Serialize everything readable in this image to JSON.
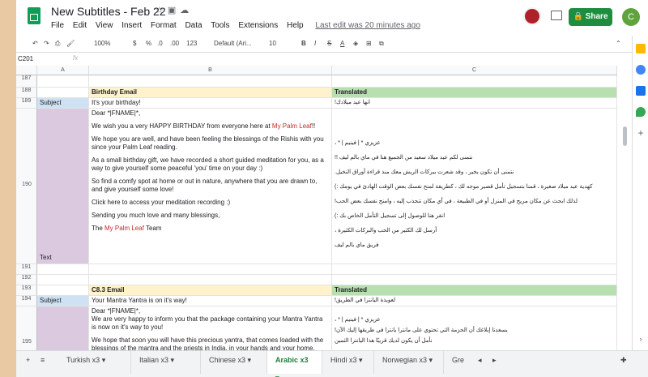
{
  "doc": {
    "title": "New Subtitles - Feb 22",
    "last_edit": "Last edit was 20 minutes ago"
  },
  "menu": [
    "File",
    "Edit",
    "View",
    "Insert",
    "Format",
    "Data",
    "Tools",
    "Extensions",
    "Help"
  ],
  "share_label": "Share",
  "avatar_letter": "C",
  "toolbar": {
    "zoom": "100%",
    "currency": "$",
    "percent": "%",
    "dec1": ".0",
    "dec2": ".00",
    "fmt": "123",
    "font": "Default (Ari...",
    "size": "10",
    "bold": "B",
    "italic": "I",
    "strike": "S",
    "color": "A"
  },
  "namebox": "C201",
  "fx": "fx",
  "columns": {
    "a": "A",
    "b": "B",
    "c": "C"
  },
  "rows": {
    "r187": "187",
    "r188": "188",
    "r189": "189",
    "r190": "190",
    "r191": "191",
    "r192": "192",
    "r193": "193",
    "r194": "194",
    "r195": "195"
  },
  "section1": {
    "heading": "Birthday Email",
    "translated": "Translated"
  },
  "row189": {
    "a": "Subject",
    "b": "It's your birthday!",
    "c": "انها عيد ميلادك!"
  },
  "row190": {
    "a": "Text",
    "b1": "Dear *|FNAME|*,",
    "b2a": "We wish you a very HAPPY BIRTHDAY from everyone here at ",
    "b2b": "My Palm Leaf",
    "b2c": "!!",
    "b3": "We hope you are well, and have been feeling the blessings of the Rishis with you since your Palm Leaf reading.",
    "b4": "As a small birthday gift, we have recorded a short guided meditation for you, as a way to give yourself some peaceful 'you' time on your day :)",
    "b5": "So find a comfy spot at home or out in nature, anywhere that you are drawn to, and give yourself some love!",
    "b6": "Click here to access your meditation recording :)",
    "b7": "Sending you much love and many blessings,",
    "b8a": "The ",
    "b8b": "My Palm Leaf",
    "b8c": " Team",
    "c1": "عزيزي * | فينيم | * ،",
    "c2": "نتمنى لكم عيد ميلاد سعيد من الجميع هنا في ماي بالم ليف !!",
    "c3": "نتمنى أن تكون بخير ، وقد شعرت ببركات الريش معك منذ قراءة أوراق النخيل.",
    "c4": "كهدية عيد ميلاد صغيرة ، قمنا بتسجيل تأمل قصير موجه لك ، كطريقة لمنح نفسك بعض الوقت الهادئ في يومك :)",
    "c5": "لذلك ابحث عن مكان مريح في المنزل أو في الطبيعة ، في أي مكان تنجذب إليه ، وامنح نفسك بعض الحب!",
    "c6": "انقر هنا للوصول إلى تسجيل التأمل الخاص بك :)",
    "c7": "أرسل لك الكثير من الحب والبركات الكثيرة ،",
    "c8": "فريق ماي بالم ليف"
  },
  "section2": {
    "heading": "C8.3  Email",
    "translated": "Translated"
  },
  "row194": {
    "a": "Subject",
    "b": "Your Mantra Yantra is on it's way!",
    "c": "لعويذة اليانترا في الطريق!"
  },
  "row195": {
    "b1": "Dear *|FNAME|*,",
    "b2": "We are very happy to inform you that the package containing your Mantra Yantra is now on it's way to you!",
    "b3": "We hope that soon you will have this precious yantra, that comes loaded with the blessings of the mantra and the priests in India, in your hands and your home.",
    "c1": "عزيزي * | فينيم | * ،",
    "c2": "يسعدنا إبلاغك أن الحزمة التي تحتوي على مانترا يانترا في طريقها إليك الآن!",
    "c3": "نأمل أن يكون لديك قريبًا هذا اليانترا الثمين"
  },
  "tabs": [
    "Turkish x3",
    "Italian x3",
    "Chinese x3",
    "Arabic x3",
    "Hindi x3",
    "Norwegian x3",
    "Gre"
  ],
  "active_tab": "Arabic x3",
  "colors": {
    "accent": "#1e8e3e",
    "header_yellow": "#fff2cc",
    "header_green": "#b7dfb0",
    "label_pink": "#dbc9e0"
  }
}
